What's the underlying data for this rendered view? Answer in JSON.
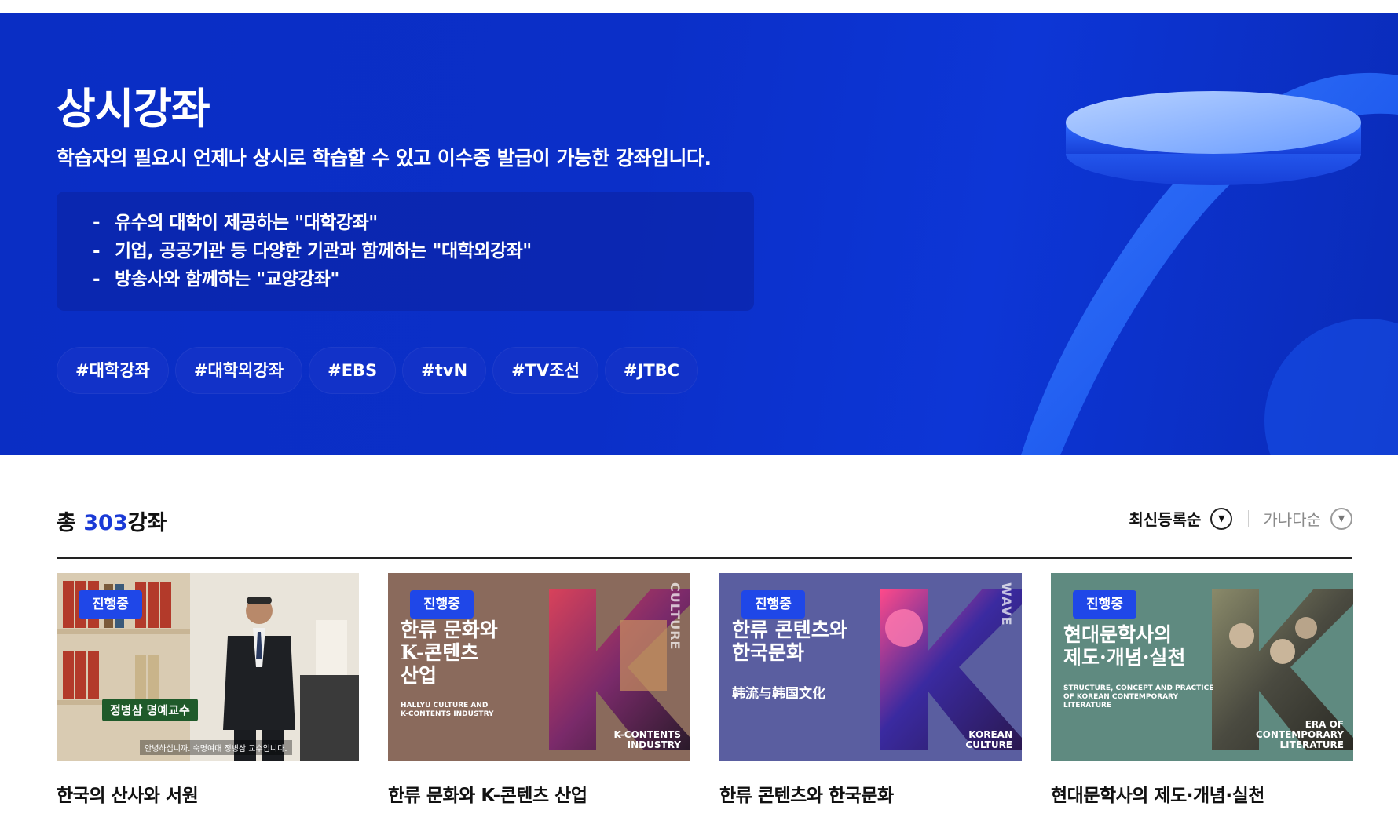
{
  "hero": {
    "title": "상시강좌",
    "subtitle": "학습자의 필요시 언제나 상시로 학습할 수 있고 이수증 발급이 가능한 강좌입니다.",
    "bullets": [
      "유수의 대학이 제공하는 \"대학강좌\"",
      "기업, 공공기관 등 다양한 기관과 함께하는 \"대학외강좌\"",
      "방송사와 함께하는 \"교양강좌\""
    ],
    "bullet_dash": "-",
    "tags": [
      "#대학강좌",
      "#대학외강좌",
      "#EBS",
      "#tvN",
      "#TV조선",
      "#JTBC"
    ]
  },
  "summary": {
    "prefix": "총 ",
    "count": "303",
    "suffix": "강좌"
  },
  "sort": {
    "options": [
      "최신등록순",
      "가나다순"
    ],
    "selected": "최신등록순"
  },
  "courses": [
    {
      "badge": "진행중",
      "title": "한국의 산사와 서원",
      "thumb_name": "정병삼 명예교수",
      "thumb_caption": "안녕하십니까. 숙명여대 정병삼 교수입니다."
    },
    {
      "badge": "진행중",
      "title": "한류 문화와 K-콘텐츠 산업",
      "thumb_title": "한류 문화와\nK-콘텐츠\n산업",
      "thumb_sub": "HALLYU CULTURE AND\nK-CONTENTS INDUSTRY",
      "thumb_corner": "K-CONTENTS\nINDUSTRY",
      "thumb_vert": "CULTURE"
    },
    {
      "badge": "진행중",
      "title": "한류 콘텐츠와 한국문화",
      "thumb_title": "한류 콘텐츠와\n한국문화",
      "thumb_sub": "韩流与韩国文化",
      "thumb_corner": "KOREAN\nCULTURE",
      "thumb_vert": "WAVE"
    },
    {
      "badge": "진행중",
      "title": "현대문학사의 제도·개념·실천",
      "thumb_title": "현대문학사의\n제도·개념·실천",
      "thumb_sub": "STRUCTURE, CONCEPT AND PRACTICE\nOF KOREAN CONTEMPORARY\nLITERATURE",
      "thumb_corner": "ERA OF\nCONTEMPORARY\nLITERATURE"
    }
  ],
  "colors": {
    "hero_bg": "#0b2fc8",
    "accent": "#1a3ad6",
    "badge": "#1f47e8"
  }
}
